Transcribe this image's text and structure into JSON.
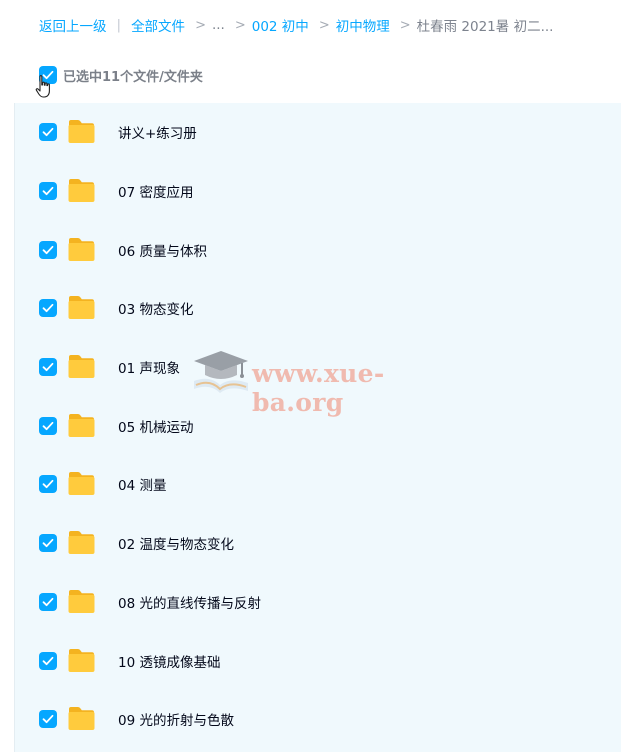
{
  "breadcrumb": {
    "back": "返回上一级",
    "separator": "|",
    "root": "全部文件",
    "arrow": ">",
    "ellipsis": "...",
    "level1": "002 初中",
    "level2": "初中物理",
    "current": "杜春雨 2021暑 初二..."
  },
  "selection": {
    "label": "已选中11个文件/文件夹",
    "checked": true
  },
  "files": [
    {
      "name": "讲义+练习册",
      "checked": true
    },
    {
      "name": "07 密度应用",
      "checked": true
    },
    {
      "name": "06 质量与体积",
      "checked": true
    },
    {
      "name": "03 物态变化",
      "checked": true
    },
    {
      "name": "01 声现象",
      "checked": true
    },
    {
      "name": "05 机械运动",
      "checked": true
    },
    {
      "name": "04 测量",
      "checked": true
    },
    {
      "name": "02 温度与物态变化",
      "checked": true
    },
    {
      "name": "08 光的直线传播与反射",
      "checked": true
    },
    {
      "name": "10 透镜成像基础",
      "checked": true
    },
    {
      "name": "09 光的折射与色散",
      "checked": true
    }
  ],
  "watermark": {
    "text": "www.xue-ba.org",
    "icon": "graduation-cap-book-icon"
  },
  "colors": {
    "accent": "#06a7ff",
    "folder": "#ffc938",
    "list_bg": "#f0f9fd",
    "text": "#03081a",
    "muted": "#7d838e"
  }
}
